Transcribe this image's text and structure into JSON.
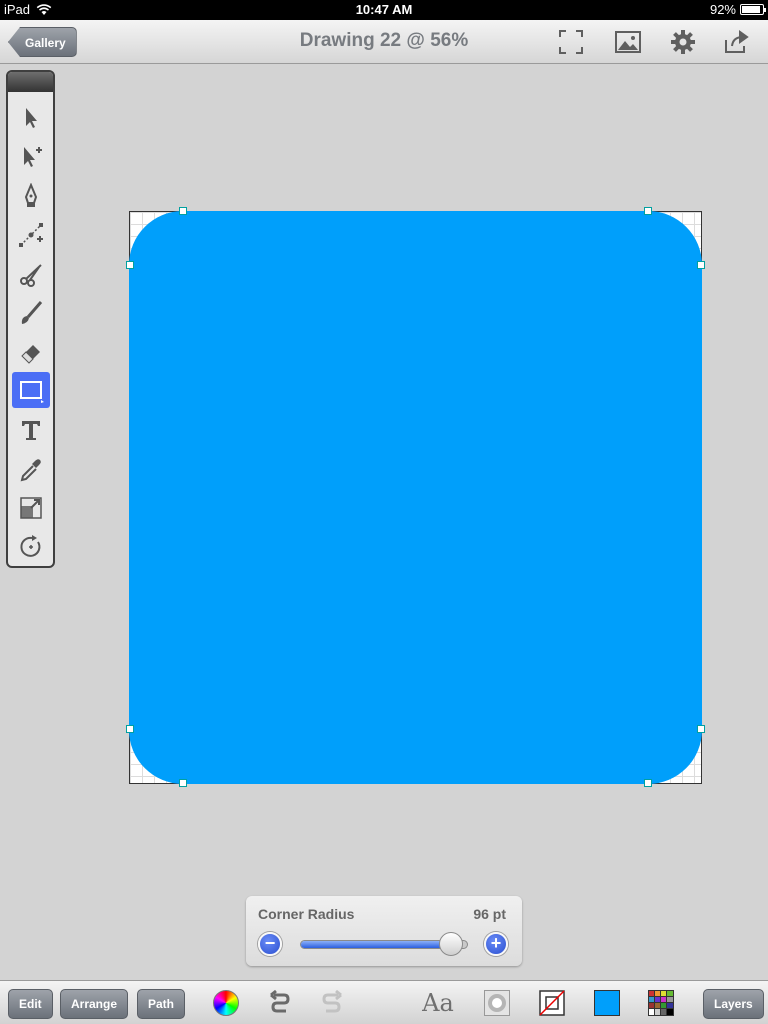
{
  "status_bar": {
    "carrier": "iPad",
    "time": "10:47 AM",
    "battery": "92%",
    "battery_level": 0.92
  },
  "nav": {
    "back_label": "Gallery",
    "title": "Drawing 22 @ 56%",
    "icons": [
      "fullscreen-icon",
      "image-icon",
      "gear-icon",
      "share-icon"
    ]
  },
  "tools": [
    "select-arrow-icon",
    "add-anchor-arrow-icon",
    "pen-icon",
    "node-edit-icon",
    "scissors-icon",
    "brush-icon",
    "eraser-icon",
    "rectangle-icon",
    "text-icon",
    "eyedropper-icon",
    "scale-icon",
    "rotate-icon"
  ],
  "active_tool": "rectangle-icon",
  "canvas": {
    "fill_color": "#009ffb"
  },
  "corner_radius": {
    "label": "Corner Radius",
    "value": "96 pt",
    "slider_level": 0.9
  },
  "bottom_bar": {
    "edit": "Edit",
    "arrange": "Arrange",
    "path": "Path",
    "font_glyph": "Aa",
    "swatch_color": "#009ffb",
    "layers": "Layers"
  }
}
